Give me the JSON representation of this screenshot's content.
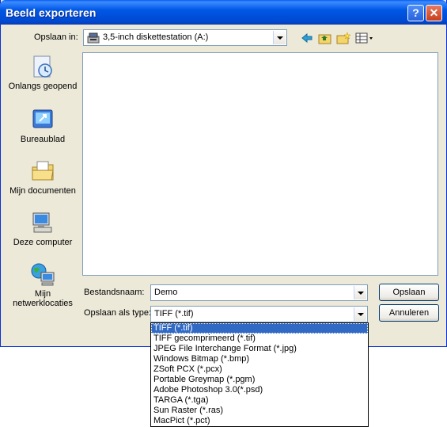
{
  "window": {
    "title": "Beeld exporteren",
    "help_button": "?",
    "close_button": "✕"
  },
  "save_in": {
    "label": "Opslaan in:",
    "value": "3,5-inch diskettestation (A:)"
  },
  "places": [
    {
      "label": "Onlangs geopend",
      "icon": "recent-documents-icon"
    },
    {
      "label": "Bureaublad",
      "icon": "desktop-icon"
    },
    {
      "label": "Mijn documenten",
      "icon": "my-documents-icon"
    },
    {
      "label": "Deze computer",
      "icon": "my-computer-icon"
    },
    {
      "label": "Mijn netwerklocaties",
      "icon": "network-places-icon"
    }
  ],
  "filename": {
    "label": "Bestandsnaam:",
    "value": "Demo"
  },
  "filetype": {
    "label": "Opslaan als type:",
    "value": "TIFF (*.tif)",
    "options": [
      "TIFF (*.tif)",
      "TIFF gecomprimeerd (*.tif)",
      "JPEG File Interchange Format (*.jpg)",
      "Windows Bitmap (*.bmp)",
      "ZSoft PCX (*.pcx)",
      "Portable Greymap (*.pgm)",
      "Adobe Photoshop 3.0(*.psd)",
      "TARGA (*.tga)",
      "Sun Raster (*.ras)",
      "MacPict (*.pct)"
    ],
    "selected_index": 0
  },
  "buttons": {
    "save": "Opslaan",
    "cancel": "Annuleren"
  }
}
